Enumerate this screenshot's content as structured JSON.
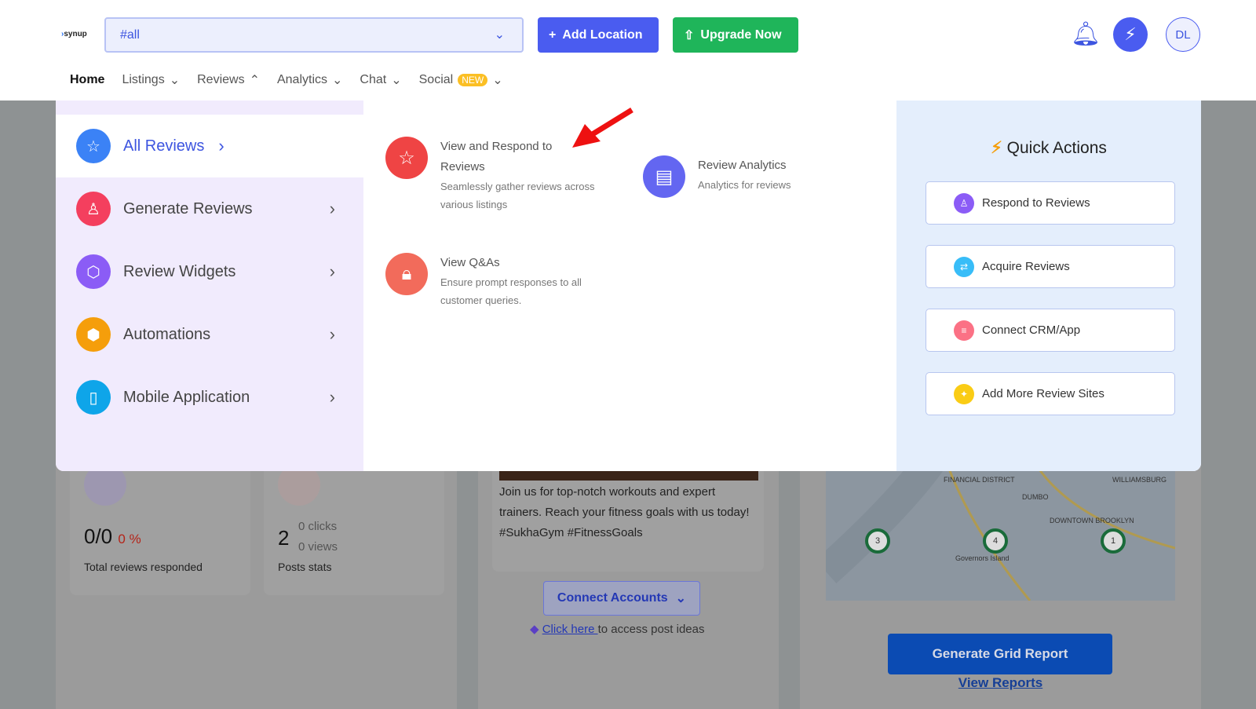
{
  "header": {
    "logo": "synup",
    "location_search": "#all",
    "add_location": "Add Location",
    "upgrade": "Upgrade Now",
    "avatar": "DL"
  },
  "nav": {
    "home": "Home",
    "listings": "Listings",
    "reviews": "Reviews",
    "analytics": "Analytics",
    "chat": "Chat",
    "social": "Social",
    "new_badge": "NEW"
  },
  "dropdown": {
    "left": [
      {
        "label": "All Reviews",
        "icon": "star-icon",
        "color": "#3b82f6"
      },
      {
        "label": "Generate Reviews",
        "icon": "user-star-icon",
        "color": "#f43f5e"
      },
      {
        "label": "Review Widgets",
        "icon": "widget-icon",
        "color": "#8b5cf6"
      },
      {
        "label": "Automations",
        "icon": "hexagon-gear-icon",
        "color": "#f59e0b"
      },
      {
        "label": "Mobile Application",
        "icon": "mobile-icon",
        "color": "#0ea5e9"
      }
    ],
    "features": [
      {
        "title": "View and Respond to Reviews",
        "desc": "Seamlessly gather reviews across various listings"
      },
      {
        "title": "Review Analytics",
        "desc": "Analytics for reviews"
      },
      {
        "title": "View Q&As",
        "desc": "Ensure prompt responses to all customer queries."
      }
    ],
    "quick_actions": {
      "title": "Quick Actions",
      "items": [
        "Respond to Reviews",
        "Acquire Reviews",
        "Connect CRM/App",
        "Add More Review Sites"
      ]
    }
  },
  "dashboard": {
    "reviews_ratio": "0/0",
    "reviews_pct": "0 %",
    "reviews_label": "Total reviews responded",
    "posts_count": "2",
    "clicks": "0 clicks",
    "views": "0 views",
    "posts_label": "Posts stats",
    "post_text": "Join us for top-notch workouts and expert trainers. Reach your fitness goals with us today! #SukhaGym #FitnessGoals",
    "connect_accounts": "Connect Accounts",
    "click_here": "Click here ",
    "post_ideas": "to access post ideas",
    "generate_grid": "Generate Grid Report",
    "view_reports": "View Reports",
    "map_labels": [
      "FINANCIAL DISTRICT",
      "DUMBO",
      "DOWNTOWN BROOKLYN",
      "Governors Island",
      "WILLIAMSBURG"
    ],
    "map_pins": [
      "3",
      "4",
      "1"
    ]
  }
}
